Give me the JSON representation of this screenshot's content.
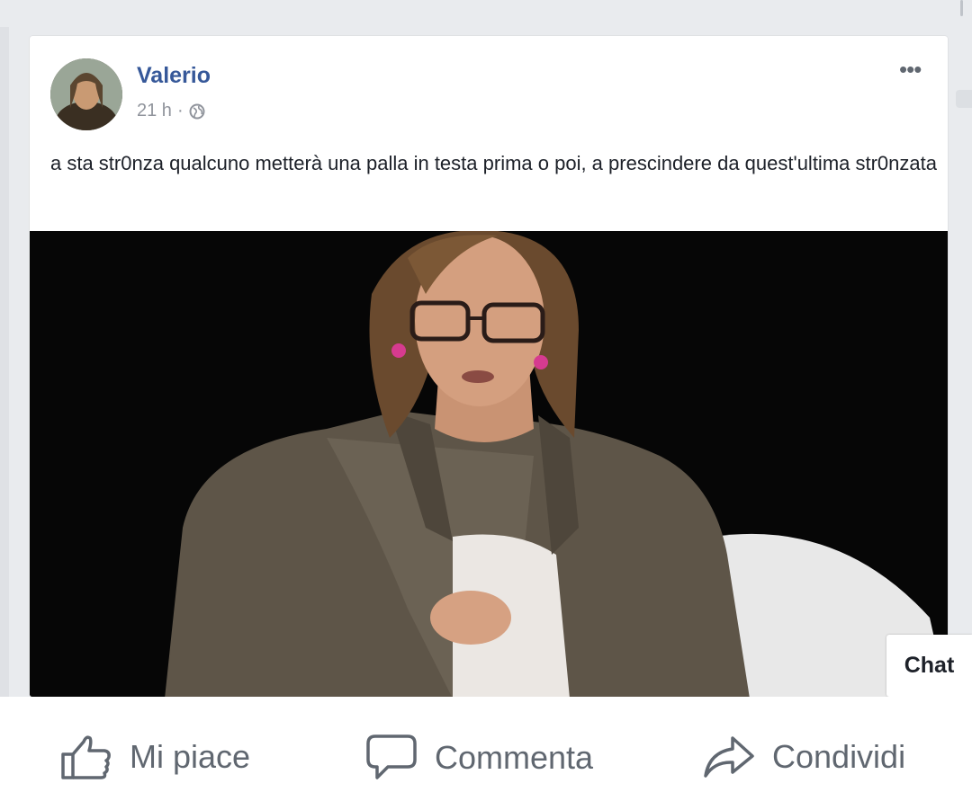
{
  "post": {
    "author": "Valerio",
    "timestamp": "21 h",
    "separator": "·",
    "audience_icon": "globe-icon",
    "more_label": "•••",
    "text": "a sta str0nza qualcuno metterà una palla in testa prima o poi, a prescindere da quest'ultima str0nzata"
  },
  "chat": {
    "label": "Chat"
  },
  "actions": {
    "like": {
      "label": "Mi piace",
      "icon": "thumbs-up-icon"
    },
    "comment": {
      "label": "Commenta",
      "icon": "speech-bubble-icon"
    },
    "share": {
      "label": "Condividi",
      "icon": "share-arrow-icon"
    }
  },
  "colors": {
    "author_link": "#365899",
    "text": "#1d2129",
    "secondary": "#90949c",
    "action_gray": "#606770",
    "page_bg": "#e9ebee"
  }
}
